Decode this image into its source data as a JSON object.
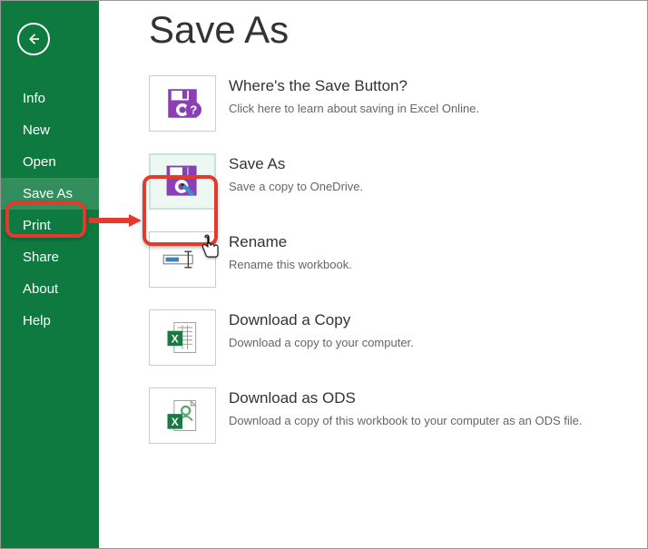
{
  "sidebar": {
    "items": [
      {
        "label": "Info"
      },
      {
        "label": "New"
      },
      {
        "label": "Open"
      },
      {
        "label": "Save As",
        "selected": true
      },
      {
        "label": "Print"
      },
      {
        "label": "Share"
      },
      {
        "label": "About"
      },
      {
        "label": "Help"
      }
    ]
  },
  "page": {
    "title": "Save As"
  },
  "options": [
    {
      "title": "Where's the Save Button?",
      "desc": "Click here to learn about saving in Excel Online."
    },
    {
      "title": "Save As",
      "desc": "Save a copy to OneDrive."
    },
    {
      "title": "Rename",
      "desc": "Rename this workbook."
    },
    {
      "title": "Download a Copy",
      "desc": "Download a copy to your computer."
    },
    {
      "title": "Download as ODS",
      "desc": "Download a copy of this workbook to your computer as an ODS file."
    }
  ]
}
